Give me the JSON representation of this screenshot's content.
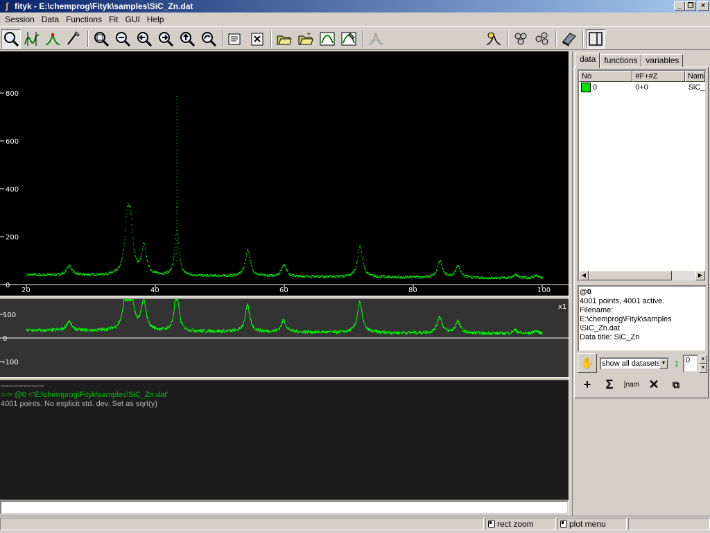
{
  "window": {
    "title": "fityk - E:\\chemprog\\Fityk\\samples\\SiC_Zn.dat"
  },
  "menu": [
    "Session",
    "Data",
    "Functions",
    "Fit",
    "GUI",
    "Help"
  ],
  "toolbar": {
    "function_type": "Constant",
    "icons": [
      "zoom-mode-icon",
      "range-mode-icon",
      "add-peak-mode-icon",
      "baseline-mode-icon",
      "zoom-all-icon",
      "zoom-vertical-icon",
      "zoom-prev-icon",
      "scroll-left-icon",
      "scroll-up-icon",
      "undo-zoom-icon",
      "info-icon",
      "settings-icon",
      "open-file-icon",
      "open-append-icon",
      "fit-icon",
      "run-fit-icon",
      "guess-icon",
      "add-function-icon",
      "cluster-icon",
      "cluster2-icon",
      "eraser-icon",
      "sidebar-toggle-icon"
    ]
  },
  "chart_data": [
    {
      "type": "scatter",
      "name": "main-plot",
      "x_ticks": [
        "20",
        "40",
        "60",
        "80",
        "100"
      ],
      "y_ticks": [
        "0",
        "200",
        "400",
        "600",
        "800"
      ],
      "xlim": [
        18,
        104
      ],
      "ylim": [
        0,
        800
      ],
      "series_color": "#00ff00",
      "peaks": [
        {
          "x": 26.6,
          "y": 40
        },
        {
          "x": 35.6,
          "y": 200
        },
        {
          "x": 36.1,
          "y": 180
        },
        {
          "x": 38.2,
          "y": 120
        },
        {
          "x": 43.3,
          "y": 200
        },
        {
          "x": 54.3,
          "y": 110
        },
        {
          "x": 59.9,
          "y": 50
        },
        {
          "x": 71.7,
          "y": 130
        },
        {
          "x": 84.1,
          "y": 70
        },
        {
          "x": 86.9,
          "y": 50
        },
        {
          "x": 95.8,
          "y": 15
        },
        {
          "x": 99.0,
          "y": 12
        }
      ],
      "baseline_y": 40
    },
    {
      "type": "line",
      "name": "aux-plot",
      "label": "x1",
      "y_ticks": [
        "-100",
        "0",
        "100"
      ],
      "ylim": [
        -160,
        160
      ]
    }
  ],
  "output": {
    "separator": "-----------------",
    "command": "=-> @0 <'E:\\chemprog\\Fityk\\samples\\SiC_Zn.dat'",
    "message": "4001 points. No explicit std. dev. Set as sqrt(y)"
  },
  "sidebar": {
    "tabs": [
      "data",
      "functions",
      "variables"
    ],
    "columns": [
      "No",
      "#F+#Z",
      "Name"
    ],
    "rows": [
      {
        "no": "0",
        "fz": "0+0",
        "name": "SiC_Zn",
        "color": "#00e000"
      }
    ],
    "info": {
      "id": "@0",
      "line1": "4001 points, 4001 active.",
      "line2": "Filename: E:\\chemprog\\Fityk\\samples",
      "line3": "\\SiC_Zn.dat",
      "line4": "Data title: SiC_Zn"
    },
    "show_select": "show all datasets",
    "spin_value": "0"
  },
  "status": {
    "left_btn": "rect zoom",
    "right_btn": "plot menu"
  }
}
